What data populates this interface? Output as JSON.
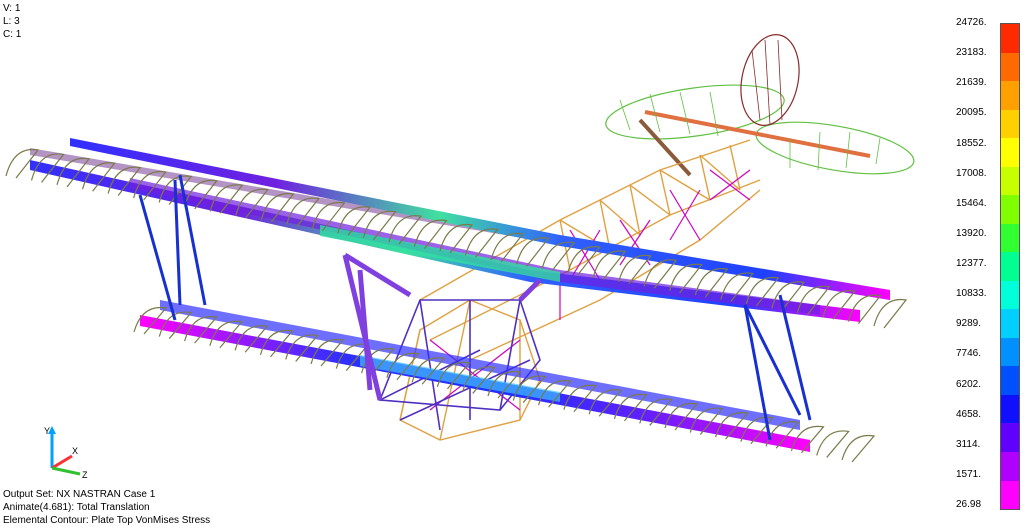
{
  "hud_top_left": {
    "view": "V: 1",
    "layer": "L: 3",
    "color": "C: 1"
  },
  "hud_bottom_left": {
    "output_set": "Output Set: NX NASTRAN Case 1",
    "animate": "Animate(4.681): Total Translation",
    "contour": "Elemental Contour: Plate Top VonMises Stress"
  },
  "legend": {
    "labels": [
      "24726.",
      "23183.",
      "21639.",
      "20095.",
      "18552.",
      "17008.",
      "15464.",
      "13920.",
      "12377.",
      "10833.",
      "9289.",
      "7746.",
      "6202.",
      "4658.",
      "3114.",
      "1571.",
      "26.98"
    ],
    "colors": [
      "#ff2a00",
      "#ff6a00",
      "#ffa000",
      "#ffd000",
      "#ffff00",
      "#c8ff00",
      "#80ff00",
      "#30ff30",
      "#00ff90",
      "#00ffd8",
      "#00d0ff",
      "#0090ff",
      "#0050ff",
      "#1010ff",
      "#6000ff",
      "#b000ff",
      "#ff00ff"
    ]
  },
  "triad": {
    "y_axis": "Y",
    "x_axis": "X",
    "z_axis": "Z"
  },
  "model": {
    "colors": {
      "wing_tip": "#7a7a4a",
      "fuselage_truss": "#e0a040",
      "magenta": "#d000c0",
      "purple": "#7040d0",
      "blue_strut": "#1830d0",
      "tail_outline": "#60c040",
      "rudder_outline": "#8a2a2a"
    }
  }
}
